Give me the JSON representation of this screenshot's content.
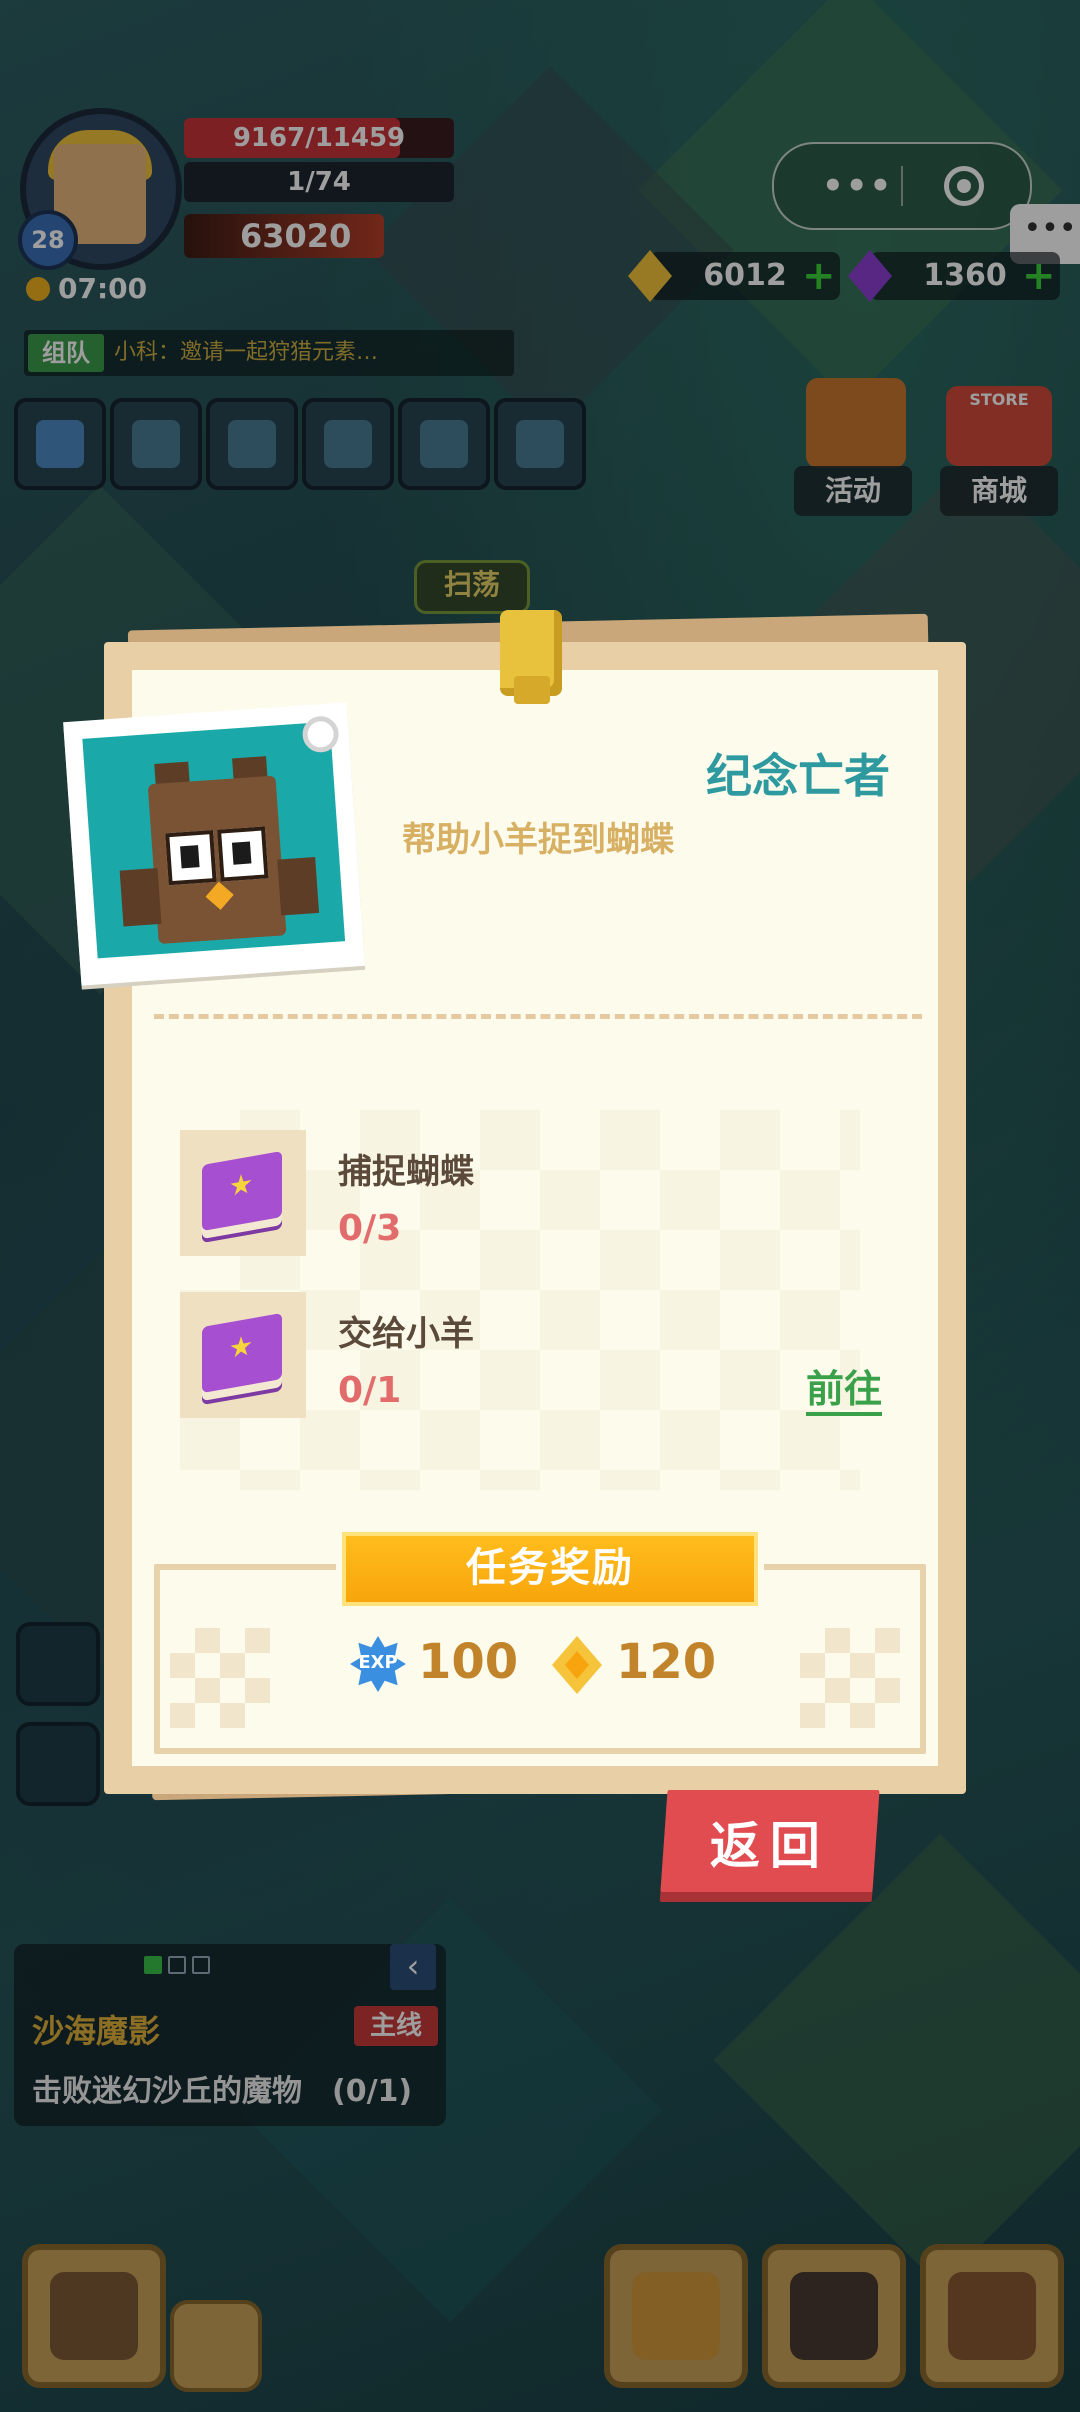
{
  "hud": {
    "level": "28",
    "hp": "9167/11459",
    "xp": "1/74",
    "power": "63020",
    "time": "07:00",
    "chat_tag": "组队",
    "chat_text": "小科：邀请一起狩猎元素…"
  },
  "currency": {
    "gold": "6012",
    "gems": "1360"
  },
  "menu": {
    "activity": "活动",
    "shop": "商城",
    "shop_sign": "STORE",
    "sweep": "扫荡"
  },
  "quest_tracker": {
    "title": "沙海魔影",
    "tag": "主线",
    "desc": "击败迷幻沙丘的魔物　(0/1)"
  },
  "modal": {
    "title": "纪念亡者",
    "subtitle": "帮助小羊捉到蝴蝶",
    "tasks": [
      {
        "name": "捕捉蝴蝶",
        "progress": "0/3"
      },
      {
        "name": "交给小羊",
        "progress": "0/1",
        "action": "前往"
      }
    ],
    "reward_header": "任务奖励",
    "rewards": [
      {
        "icon": "exp-icon",
        "label": "EXP",
        "value": "100"
      },
      {
        "icon": "gold-coin-icon",
        "value": "120"
      }
    ],
    "return_label": "返回"
  },
  "colors": {
    "title_teal": "#2e9aa0",
    "subtitle_gold": "#d8b064",
    "progress_red": "#e26c6c",
    "goto_green": "#3aa04a",
    "reward_orange": "#f8a50b",
    "return_red": "#e04c50"
  }
}
